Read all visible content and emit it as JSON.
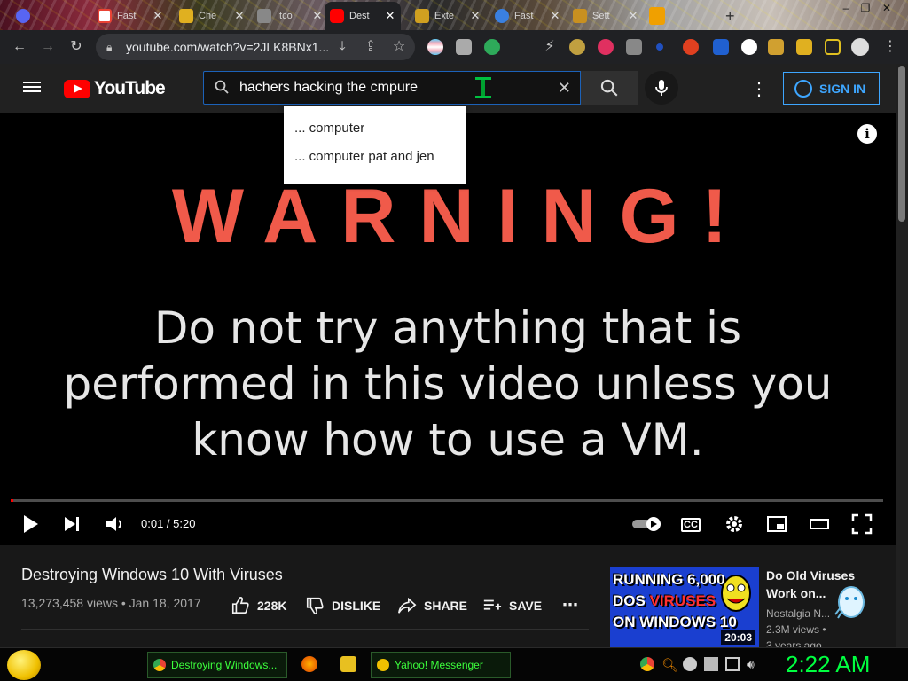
{
  "colors": {
    "youtube_red": "#ff0000",
    "accent_blue": "#3ea6ff",
    "warning_red": "#f05a4a",
    "taskbar_green": "#3cff3c",
    "clock_green": "#00ff40"
  },
  "browser": {
    "tabs": [
      {
        "title": "Fast",
        "icon": "gmail-icon",
        "active": false
      },
      {
        "title": "Che",
        "icon": "extension-icon",
        "active": false
      },
      {
        "title": "Itco",
        "icon": "page-icon",
        "active": false
      },
      {
        "title": "Dest",
        "icon": "youtube-icon",
        "active": true
      },
      {
        "title": "Exte",
        "icon": "extension-icon",
        "active": false
      },
      {
        "title": "Fast",
        "icon": "globe-icon",
        "active": false
      },
      {
        "title": "Sett",
        "icon": "gear-icon",
        "active": false
      }
    ],
    "url": "youtube.com/watch?v=2JLK8BNx1..."
  },
  "youtube": {
    "logo_text": "YouTube",
    "search_query": "hachers hacking the cmpure",
    "signin_label": "SIGN IN",
    "suggestions": [
      "... computer",
      "... computer pat and jen"
    ]
  },
  "video": {
    "warning_title": "WARNING!",
    "warning_line1": "Do not try anything that is",
    "warning_line2": "performed in this video unless you",
    "warning_line3": "know how to use a VM.",
    "time": "0:01 / 5:20",
    "progress_fraction": 0.003,
    "cc_label": "CC"
  },
  "details": {
    "title": "Destroying Windows 10 With Viruses",
    "meta": "13,273,458 views • Jan 18, 2017",
    "likes": "228K",
    "dislike_label": "DISLIKE",
    "share_label": "SHARE",
    "save_label": "SAVE"
  },
  "recommendation": {
    "thumb_line1": "RUNNING 6,000",
    "thumb_line2a": "DOS ",
    "thumb_line2b": "VIRUSES",
    "thumb_line3": "ON WINDOWS 10",
    "duration": "20:03",
    "title": "Do Old Viruses Work on...",
    "channel": "Nostalgia N...",
    "views": "2.3M views •",
    "age": "3 years ago"
  },
  "taskbar": {
    "tasks": [
      "Destroying Windows...",
      "Yahoo! Messenger"
    ],
    "clock": "2:22 AM"
  }
}
